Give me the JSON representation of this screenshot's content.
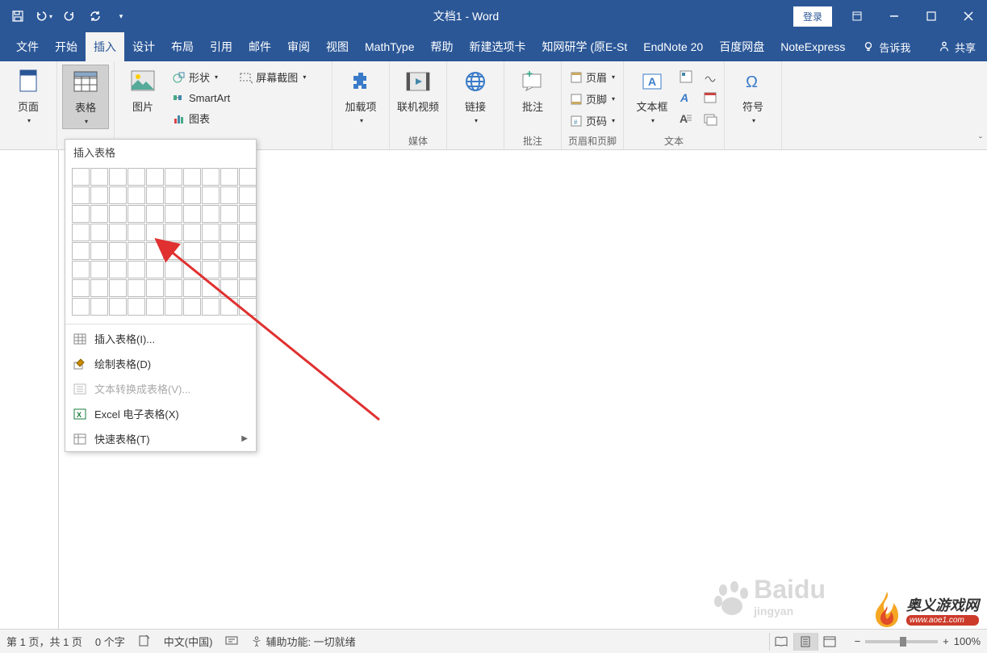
{
  "title": "文档1 - Word",
  "login_label": "登录",
  "ribbon_tabs": [
    "文件",
    "开始",
    "插入",
    "设计",
    "布局",
    "引用",
    "邮件",
    "审阅",
    "视图",
    "MathType",
    "帮助",
    "新建选项卡",
    "知网研学 (原E-St",
    "EndNote 20",
    "百度网盘",
    "NoteExpress"
  ],
  "tell_me": "告诉我",
  "share": "共享",
  "ribbon": {
    "page": "页面",
    "table": "表格",
    "picture": "图片",
    "shapes": "形状",
    "smartart": "SmartArt",
    "chart": "图表",
    "screenshot": "屏幕截图",
    "addin": "加载项",
    "online_video": "联机视频",
    "links": "链接",
    "comment": "批注",
    "header": "页眉",
    "footer": "页脚",
    "page_number": "页码",
    "text_box": "文本框",
    "symbol": "符号",
    "group_media": "媒体",
    "group_comment": "批注",
    "group_header_footer": "页眉和页脚",
    "group_text": "文本"
  },
  "table_dropdown": {
    "header": "插入表格",
    "menu_insert": "插入表格(I)...",
    "menu_draw": "绘制表格(D)",
    "menu_convert": "文本转换成表格(V)...",
    "menu_excel": "Excel 电子表格(X)",
    "menu_quick": "快速表格(T)"
  },
  "statusbar": {
    "page_info": "第 1 页，共 1 页",
    "word_count": "0 个字",
    "language": "中文(中国)",
    "accessibility": "辅助功能: 一切就绪",
    "zoom": "100%"
  },
  "watermark": {
    "baidu": "Baidu",
    "baidu_sub": "jingyan",
    "site_name": "奥义游戏网",
    "site_url": "www.aoe1.com"
  }
}
